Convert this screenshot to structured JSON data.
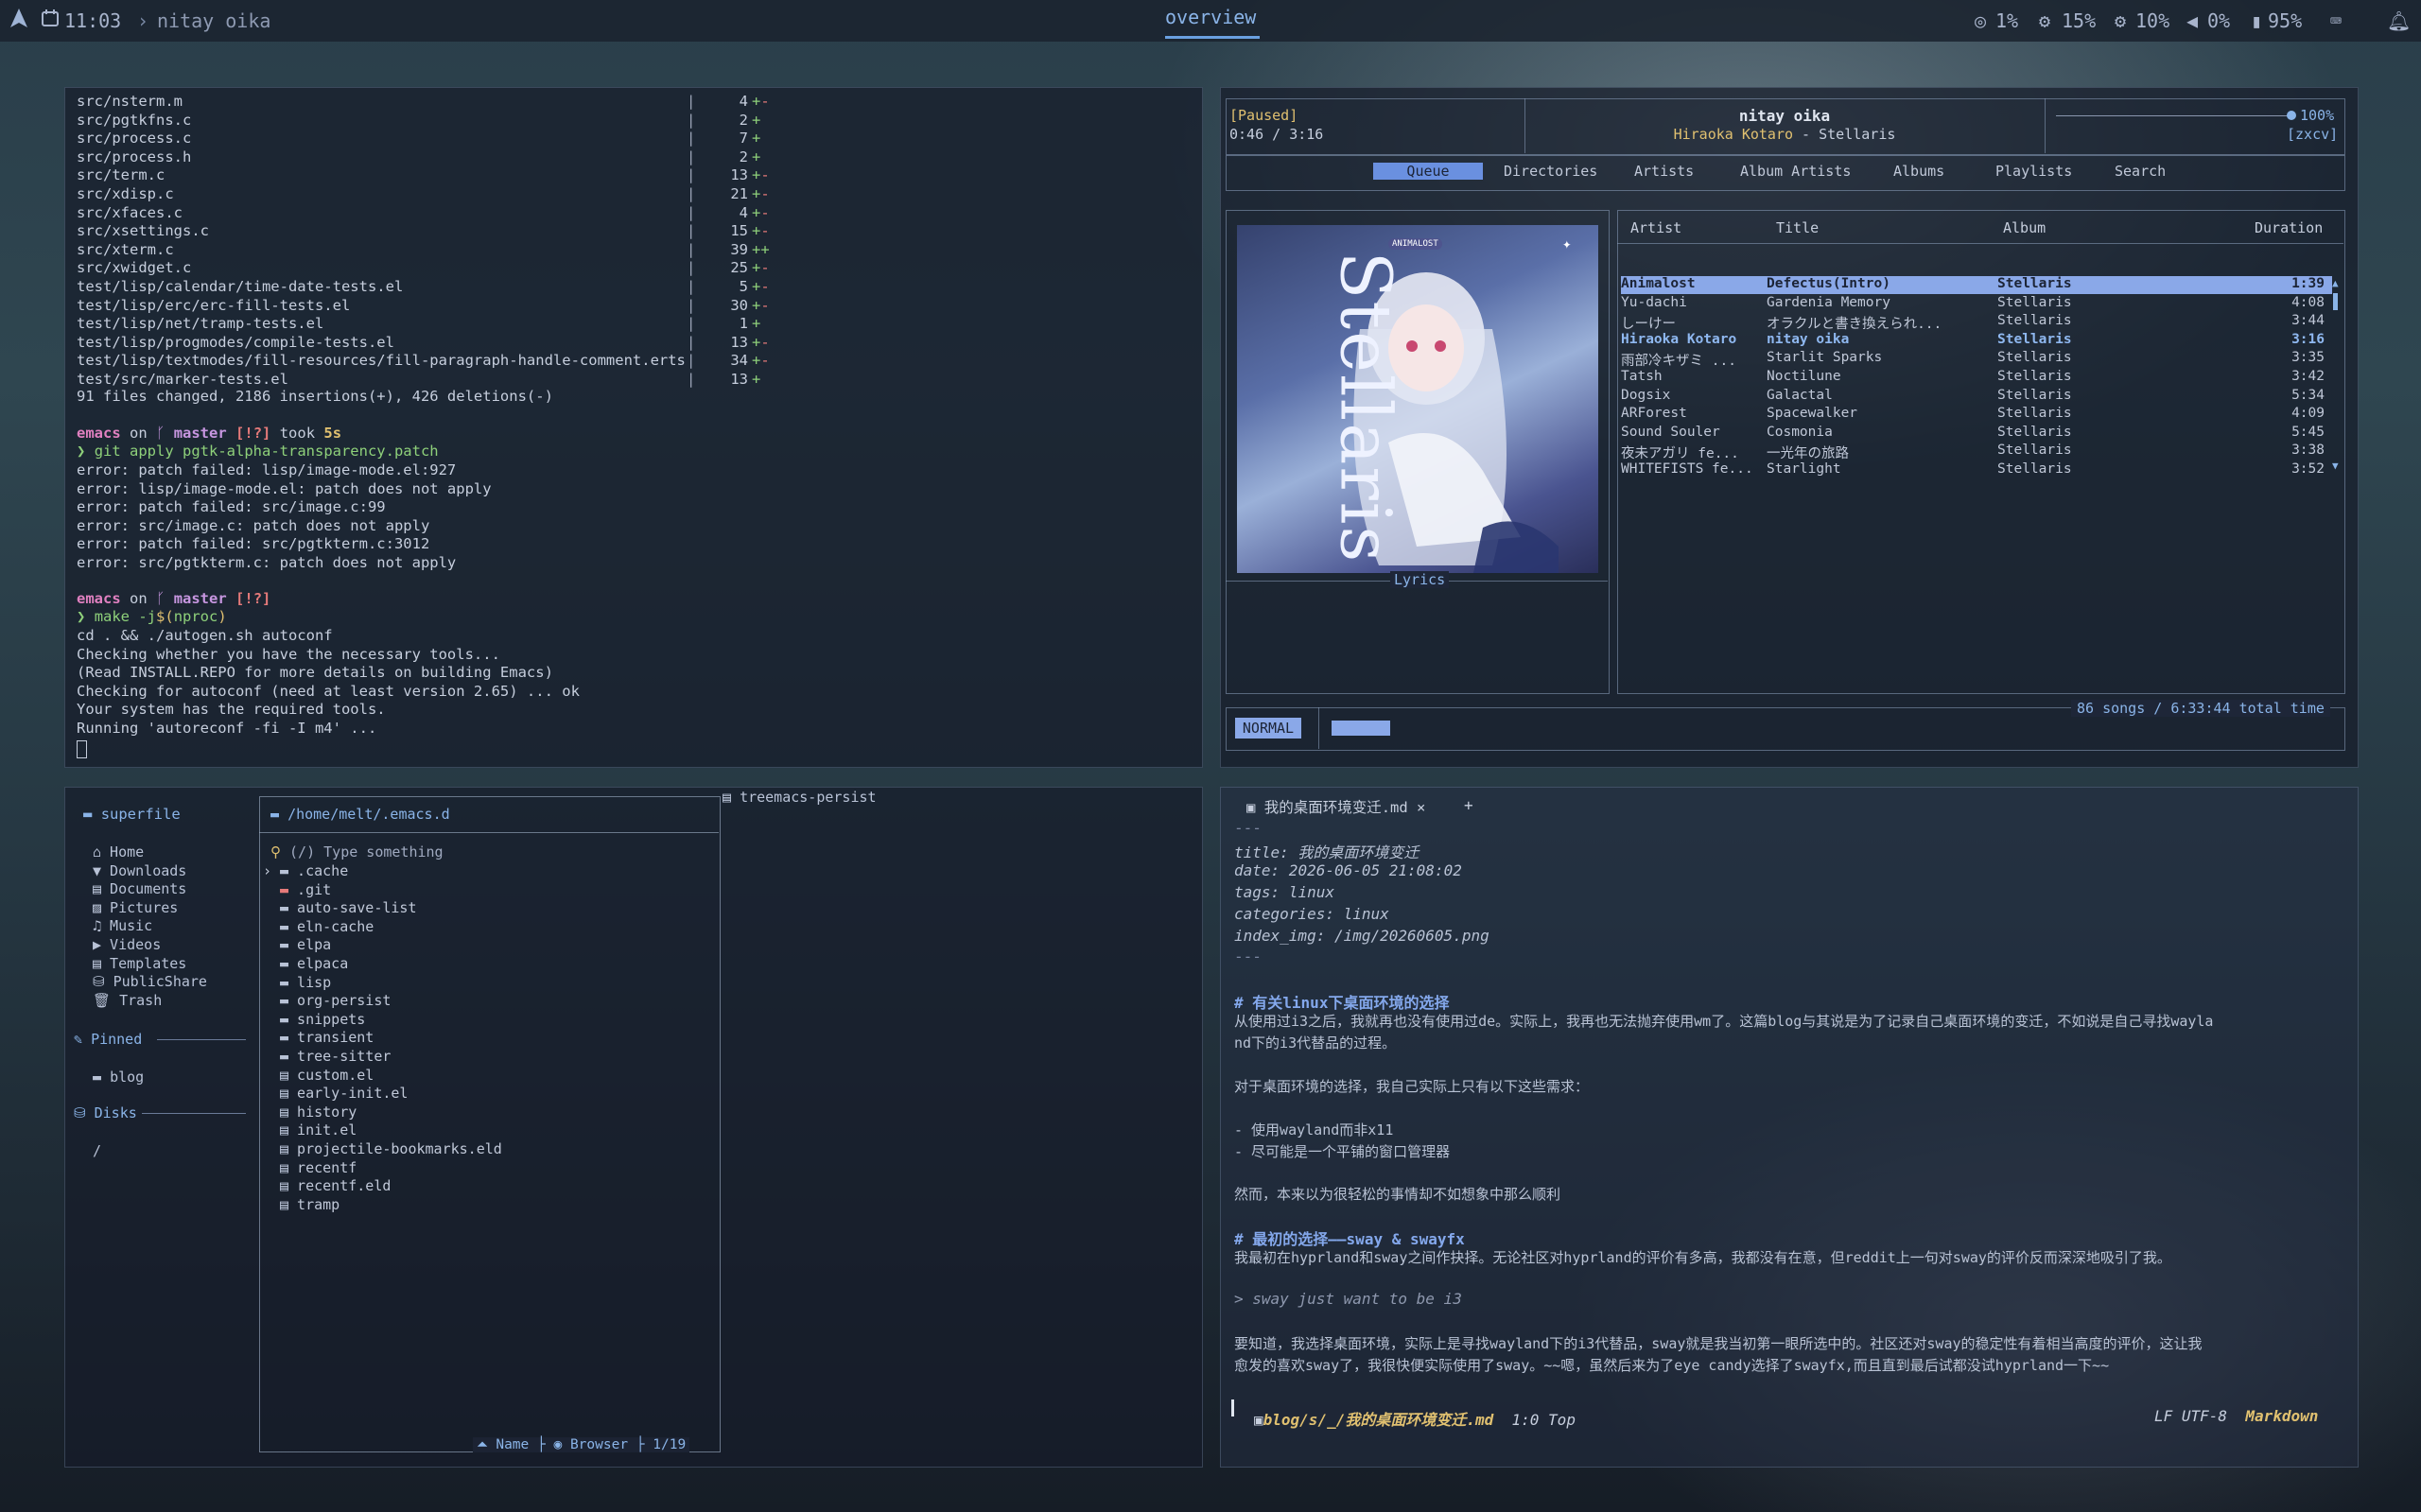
{
  "topbar": {
    "launcher_icon": "arch-logo-icon",
    "time": "11:03",
    "window_title": "nitay oika",
    "workspace": "overview",
    "cpu": "1%",
    "mem": "15%",
    "temp": "10%",
    "volume": "0%",
    "battery": "95%"
  },
  "terminal": {
    "diffstat": [
      {
        "file": "src/nsterm.m",
        "n": "4",
        "s": "+-"
      },
      {
        "file": "src/pgtkfns.c",
        "n": "2",
        "s": "+"
      },
      {
        "file": "src/process.c",
        "n": "7",
        "s": "+"
      },
      {
        "file": "src/process.h",
        "n": "2",
        "s": "+"
      },
      {
        "file": "src/term.c",
        "n": "13",
        "s": "+-"
      },
      {
        "file": "src/xdisp.c",
        "n": "21",
        "s": "+-"
      },
      {
        "file": "src/xfaces.c",
        "n": "4",
        "s": "+-"
      },
      {
        "file": "src/xsettings.c",
        "n": "15",
        "s": "+-"
      },
      {
        "file": "src/xterm.c",
        "n": "39",
        "s": "++"
      },
      {
        "file": "src/xwidget.c",
        "n": "25",
        "s": "+-"
      },
      {
        "file": "test/lisp/calendar/time-date-tests.el",
        "n": "5",
        "s": "+-"
      },
      {
        "file": "test/lisp/erc/erc-fill-tests.el",
        "n": "30",
        "s": "+-"
      },
      {
        "file": "test/lisp/net/tramp-tests.el",
        "n": "1",
        "s": "+"
      },
      {
        "file": "test/lisp/progmodes/compile-tests.el",
        "n": "13",
        "s": "+-"
      },
      {
        "file": "test/lisp/textmodes/fill-resources/fill-paragraph-handle-comment.erts",
        "n": "34",
        "s": "+-"
      },
      {
        "file": "test/src/marker-tests.el",
        "n": "13",
        "s": "+"
      }
    ],
    "summary": "91 files changed, 2186 insertions(+), 426 deletions(-)",
    "prompt1": {
      "user": "emacs",
      "on": "on",
      "branch_icon": "git-branch-icon",
      "branch": "master",
      "flags": "[!?]",
      "took": "took",
      "time": "5s"
    },
    "cmd1": "git apply pgtk-alpha-transparency.patch",
    "errors": [
      "error: patch failed: lisp/image-mode.el:927",
      "error: lisp/image-mode.el: patch does not apply",
      "error: patch failed: src/image.c:99",
      "error: src/image.c: patch does not apply",
      "error: patch failed: src/pgtkterm.c:3012",
      "error: src/pgtkterm.c: patch does not apply"
    ],
    "prompt2": {
      "user": "emacs",
      "on": "on",
      "branch": "master",
      "flags": "[!?]"
    },
    "cmd2_a": "make -j",
    "cmd2_b": "$(",
    "cmd2_c": "nproc",
    "cmd2_d": ")",
    "output": [
      "cd . && ./autogen.sh autoconf",
      "Checking whether you have the necessary tools...",
      "(Read INSTALL.REPO for more details on building Emacs)",
      "Checking for autoconf (need at least version 2.65) ... ok",
      "Your system has the required tools.",
      "Running 'autoreconf -fi -I m4' ..."
    ],
    "prompt_char": "❯"
  },
  "player": {
    "state": "[Paused]",
    "elapsed": "0:46 / 3:16",
    "song": "nitay oika",
    "artist": "Hiraoka Kotaro",
    "sep": " - ",
    "album": "Stellaris",
    "volume": "100%",
    "modes": "[zxcv]",
    "tabs": [
      "Queue",
      "Directories",
      "Artists",
      "Album Artists",
      "Albums",
      "Playlists",
      "Search"
    ],
    "cover_title": "Stellaris",
    "cover_label": "ANIMALOST",
    "lyrics_label": "Lyrics",
    "columns": {
      "artist": "Artist",
      "title": "Title",
      "album": "Album",
      "duration": "Duration"
    },
    "queue": [
      {
        "artist": "Animalost",
        "title": "Defectus(Intro)",
        "album": "Stellaris",
        "duration": "1:39",
        "state": "selected"
      },
      {
        "artist": "Yu-dachi",
        "title": "Gardenia Memory",
        "album": "Stellaris",
        "duration": "4:08",
        "state": ""
      },
      {
        "artist": "しーけー",
        "title": "オラクルと書き換えられ...",
        "album": "Stellaris",
        "duration": "3:44",
        "state": ""
      },
      {
        "artist": "Hiraoka Kotaro",
        "title": "nitay oika",
        "album": "Stellaris",
        "duration": "3:16",
        "state": "playing"
      },
      {
        "artist": "雨部冷キザミ ...",
        "title": "Starlit Sparks",
        "album": "Stellaris",
        "duration": "3:35",
        "state": ""
      },
      {
        "artist": "Tatsh",
        "title": "Noctilune",
        "album": "Stellaris",
        "duration": "3:42",
        "state": ""
      },
      {
        "artist": "Dogsix",
        "title": "Galactal",
        "album": "Stellaris",
        "duration": "5:34",
        "state": ""
      },
      {
        "artist": "ARForest",
        "title": "Spacewalker",
        "album": "Stellaris",
        "duration": "4:09",
        "state": ""
      },
      {
        "artist": "Sound Souler",
        "title": "Cosmonia",
        "album": "Stellaris",
        "duration": "5:45",
        "state": ""
      },
      {
        "artist": "夜未アガリ fe...",
        "title": "一光年の旅路",
        "album": "Stellaris",
        "duration": "3:38",
        "state": ""
      },
      {
        "artist": "WHITEFISTS fe...",
        "title": "Starlight",
        "album": "Stellaris",
        "duration": "3:52",
        "state": ""
      }
    ],
    "mode": "NORMAL",
    "progress": 0.235,
    "total": "86 songs / 6:33:44 total time"
  },
  "filemanager": {
    "title": "superfile",
    "places": [
      "Home",
      "Downloads",
      "Documents",
      "Pictures",
      "Music",
      "Videos",
      "Templates",
      "PublicShare",
      "Trash"
    ],
    "pinned_label": "Pinned",
    "pinned": [
      "blog"
    ],
    "disks_label": "Disks",
    "disks": [
      "/"
    ],
    "path": "/home/melt/.emacs.d",
    "search_placeholder": "(/) Type something",
    "files": [
      ".cache",
      ".git",
      "auto-save-list",
      "eln-cache",
      "elpa",
      "elpaca",
      "lisp",
      "org-persist",
      "snippets",
      "transient",
      "tree-sitter",
      "custom.el",
      "early-init.el",
      "history",
      "init.el",
      "projectile-bookmarks.eld",
      "recentf",
      "recentf.eld",
      "tramp"
    ],
    "preview_name": "treemacs-persist",
    "footer_sort": "Name",
    "footer_mode": "Browser",
    "footer_count": "1/19"
  },
  "emacs": {
    "tab_title": "我的桌面环境变迁.md",
    "tab_close": "×",
    "tab_new": "+",
    "fm_dash": "---",
    "fm_title_k": "title:",
    "fm_title_v": " 我的桌面环境变迁",
    "fm_date_k": "date:",
    "fm_date_v": " 2026-06-05 21:08:02",
    "fm_tags_k": "tags:",
    "fm_tags_v": " linux",
    "fm_cat_k": "categories:",
    "fm_cat_v": " linux",
    "fm_img_k": "index_img:",
    "fm_img_v": " /img/20260605.png",
    "h1_mark": "#",
    "h1": "有关linux下桌面环境的选择",
    "p1a": "从使用过i3之后，我就再也没有使用过de。实际上，我再也无法抛弃使用wm了。这篇blog与其说是为了记录自己桌面环境的变迁，不如说是自己寻找wayla",
    "p1b": "nd下的i3代替品的过程。",
    "p2": "对于桌面环境的选择，我自己实际上只有以下这些需求：",
    "li1": "- 使用wayland而非x11",
    "li2": "- 尽可能是一个平铺的窗口管理器",
    "p3": "然而，本来以为很轻松的事情却不如想象中那么顺利",
    "h2_mark": "#",
    "h2": "最初的选择——sway & swayfx",
    "p4": "我最初在hyprland和sway之间作抉择。无论社区对hyprland的评价有多高，我都没有在意，但reddit上一句对sway的评价反而深深地吸引了我。",
    "quote": "> sway just want to be i3",
    "p5a": "要知道，我选择桌面环境，实际上是寻找wayland下的i3代替品，sway就是我当初第一眼所选中的。社区还对sway的稳定性有着相当高度的评价，这让我",
    "p5b": "愈发的喜欢sway了，我很快便实际使用了sway。~~嗯，虽然后来为了eye candy选择了swayfx,而且直到最后试都没试hyprland一下~~",
    "modeline_path": "blog/s/_/我的桌面环境变迁.md",
    "modeline_pos": "1:0 Top",
    "modeline_enc": "LF UTF-8",
    "modeline_mode": "Markdown"
  },
  "colors": {
    "accent": "#6aa0e0",
    "selected_row": "#8aa8e8",
    "playing": "#8fb8f0",
    "green": "#8ed07a",
    "red": "#e67a7a",
    "yellow": "#e0c070"
  }
}
